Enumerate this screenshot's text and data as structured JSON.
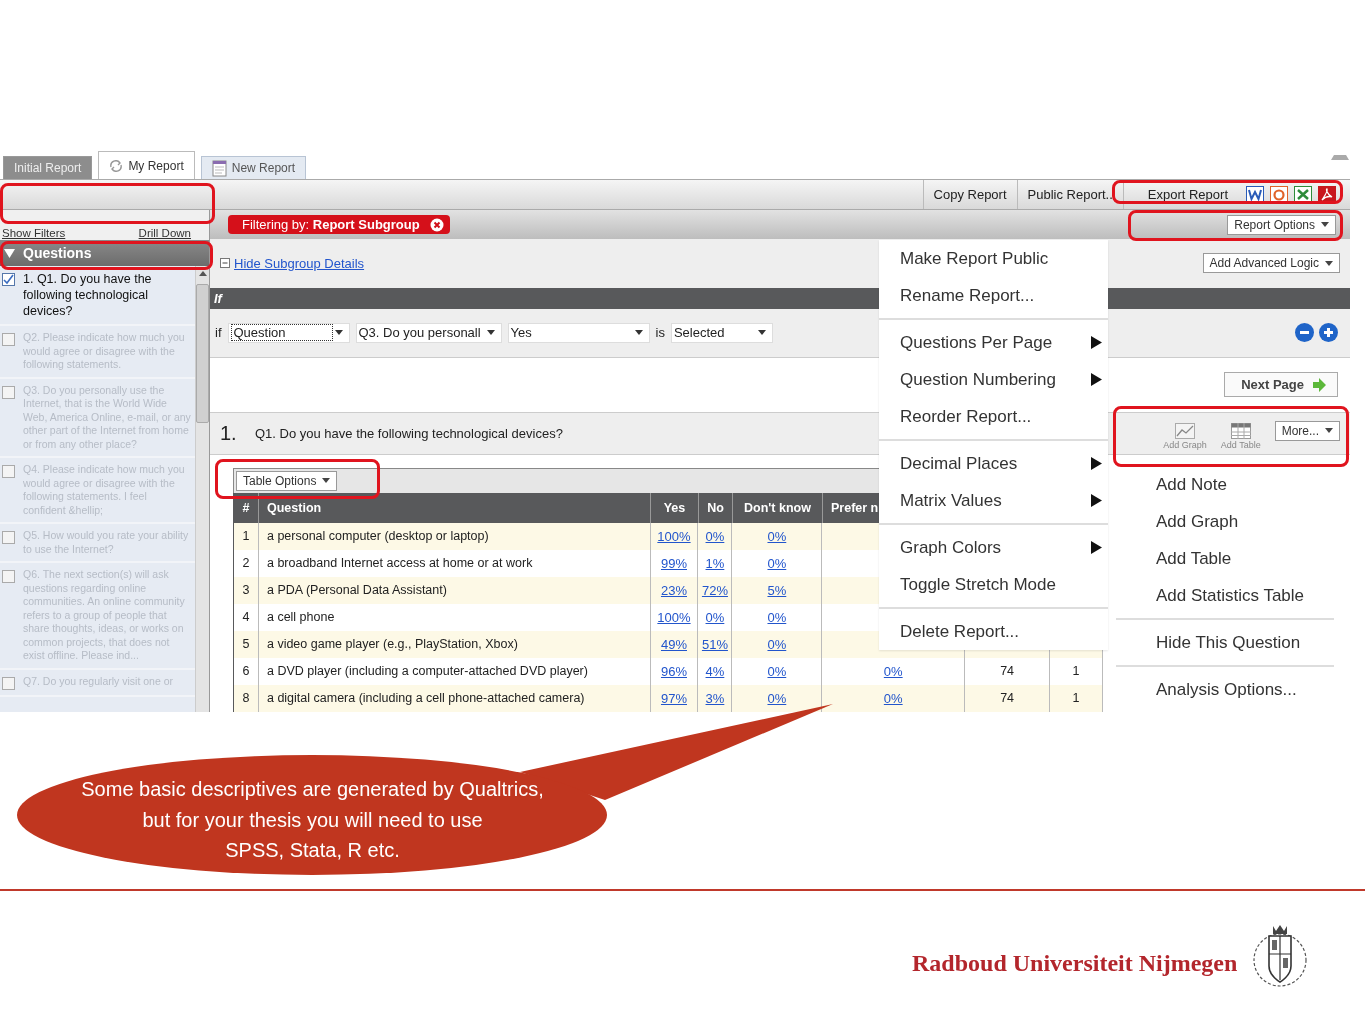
{
  "tabs": [
    {
      "label": "Initial Report",
      "selected": false,
      "kind": "report"
    },
    {
      "label": "My Report",
      "selected": true,
      "kind": "linked"
    },
    {
      "label": "New Report",
      "selected": false,
      "kind": "new"
    }
  ],
  "toolbar": {
    "actions": [
      "Copy Report",
      "Public Report.."
    ],
    "export": {
      "label": "Export Report",
      "formats": [
        {
          "kind": "word"
        },
        {
          "kind": "slides"
        },
        {
          "kind": "sheet"
        },
        {
          "kind": "pdf"
        }
      ]
    }
  },
  "sidebar": {
    "links": [
      "Show Filters",
      "Drill Down"
    ],
    "header": "Questions",
    "questions": [
      {
        "text": "1. Q1. Do you have the following technological devices?",
        "checked": true,
        "selected": true
      },
      {
        "text": "Q2. Please indicate how much you would agree or disagree with the following statements.",
        "checked": false,
        "selected": false
      },
      {
        "text": "Q3. Do you personally use the Internet, that is the World Wide Web, America Online, e-mail, or any other part of the Internet from home or from any other place?",
        "checked": false,
        "selected": false
      },
      {
        "text": "Q4. Please indicate how much you would agree or disagree with the following statements. I feel confident &hellip;",
        "checked": false,
        "selected": false
      },
      {
        "text": "Q5. How would you rate your ability to use the Internet?",
        "checked": false,
        "selected": false
      },
      {
        "text": "Q6. The next section(s) will ask questions regarding online communities. An online community refers to a group of people that share thoughts, ideas, or works on common projects, that does not exist offline. Please ind...",
        "checked": false,
        "selected": false
      },
      {
        "text": "Q7. Do you regularly visit one or",
        "checked": false,
        "selected": false
      }
    ]
  },
  "filter_badge": "Filtering by: **Report Subgroup**",
  "report_options": "Report Options",
  "hide_link": "Hide Subgroup Details",
  "advanced_logic": "Add Advanced Logic",
  "logic_header": "If",
  "condition": {
    "prefix": "if",
    "fields": [
      {
        "value": "Question"
      },
      {
        "value": "Q3. Do you personall"
      },
      {
        "value": "Yes"
      }
    ],
    "operator": "is",
    "state": "Selected"
  },
  "next_page": "Next Page",
  "question": {
    "number": "1.",
    "text": "Q1. Do you have the following technological devices?"
  },
  "question_tools": [
    "Add Graph",
    "Add Table"
  ],
  "more": "More...",
  "table_options": "Table Options",
  "table": {
    "columns": [
      "#",
      "Question",
      "Yes",
      "No",
      "Don't know",
      "Prefer n"
    ],
    "rows": [
      {
        "cells": [
          "1",
          "a personal computer (desktop or laptop)",
          "100%",
          "0%",
          "0%"
        ]
      },
      {
        "cells": [
          "2",
          "a broadband Internet access at home or at work",
          "99%",
          "1%",
          "0%"
        ]
      },
      {
        "cells": [
          "3",
          "a PDA (Personal Data Assistant)",
          "23%",
          "72%",
          "5%"
        ]
      },
      {
        "cells": [
          "4",
          "a cell phone",
          "100%",
          "0%",
          "0%"
        ]
      },
      {
        "cells": [
          "5",
          "a video game player (e.g., PlayStation, Xbox)",
          "49%",
          "51%",
          "0%"
        ]
      },
      {
        "cells": [
          "6",
          "a DVD player (including a computer-attached DVD player)",
          "96%",
          "4%",
          "0%",
          "0%",
          "74",
          "1"
        ]
      },
      {
        "cells": [
          "8",
          "a digital camera (including a cell phone-attached camera)",
          "97%",
          "3%",
          "0%",
          "0%",
          "74",
          "1"
        ]
      }
    ]
  },
  "report_menu": [
    [
      {
        "label": "Make Report Public",
        "submenu": false
      },
      {
        "label": "Rename Report...",
        "submenu": false
      }
    ],
    [
      {
        "label": "Questions Per Page",
        "submenu": true
      },
      {
        "label": "Question Numbering",
        "submenu": true
      },
      {
        "label": "Reorder Report...",
        "submenu": false
      }
    ],
    [
      {
        "label": "Decimal Places",
        "submenu": true
      },
      {
        "label": "Matrix Values",
        "submenu": true
      }
    ],
    [
      {
        "label": "Graph Colors",
        "submenu": true
      },
      {
        "label": "Toggle Stretch Mode",
        "submenu": false
      }
    ],
    [
      {
        "label": "Delete Report...",
        "submenu": false
      }
    ]
  ],
  "more_menu": [
    [
      "Add Note",
      "Add Graph",
      "Add Table",
      "Add Statistics Table"
    ],
    [
      "Hide This Question"
    ],
    [
      "Analysis Options..."
    ]
  ],
  "callout": [
    "Some basic descriptives are generated by Qualtrics,",
    "but for your thesis you will need to use",
    "SPSS, Stata, R etc."
  ],
  "footer": "Radboud Universiteit Nijmegen"
}
